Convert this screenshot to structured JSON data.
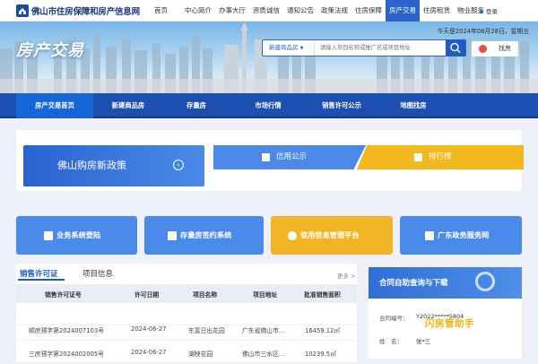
{
  "site": {
    "title": "佛山市住房保障和房产信息网"
  },
  "topnav": [
    "首页",
    "中心简介",
    "办事大厅",
    "资质诚信",
    "通知公告",
    "政策法规",
    "住房保障",
    "房产交易",
    "住房租赁",
    "物业服务"
  ],
  "login": "登录",
  "banner": {
    "title": "房产交易",
    "date": "今天是2024年06月28日，星期五"
  },
  "search": {
    "type": "新建商品房",
    "placeholder": "请输入项目名称或推广名或项目地址",
    "findhouse": "找房"
  },
  "mainnav": [
    "房产交易首页",
    "新建商品房",
    "存量房",
    "市场行情",
    "销售许可公示",
    "地图找房"
  ],
  "promo": {
    "policy": "佛山购房新政策",
    "public": "信用公示",
    "rank": "排行榜"
  },
  "services": [
    "业务系统登陆",
    "存量房签约系统",
    "信用信息管理平台",
    "广东政务服务网"
  ],
  "list": {
    "tabs": [
      "销售许可证",
      "项目信息"
    ],
    "more": "更多 >",
    "headers": [
      "销售许可证号",
      "许可日期",
      "项目名称",
      "项目地址",
      "批准销售面积"
    ],
    "rows": [
      {
        "no": "",
        "date": "",
        "name": "",
        "addr": "",
        "area": ""
      },
      {
        "no": "顺房预字第2024007103号",
        "date": "2024-06-27",
        "name": "东富日出花园",
        "addr": "广东省佛山市...",
        "area": "16459.12㎡"
      },
      {
        "no": "三房预字第2024002005号",
        "date": "2024-06-27",
        "name": "湖映花园",
        "addr": "佛山市三水区...",
        "area": "10239.5㎡"
      }
    ]
  },
  "selfquery": {
    "title": "合同自助查询与下载",
    "labels": [
      "合同编号：",
      "姓　名："
    ],
    "values": [
      "Y2022*****5804",
      "张*三"
    ]
  },
  "watermark": "闪房管助手"
}
